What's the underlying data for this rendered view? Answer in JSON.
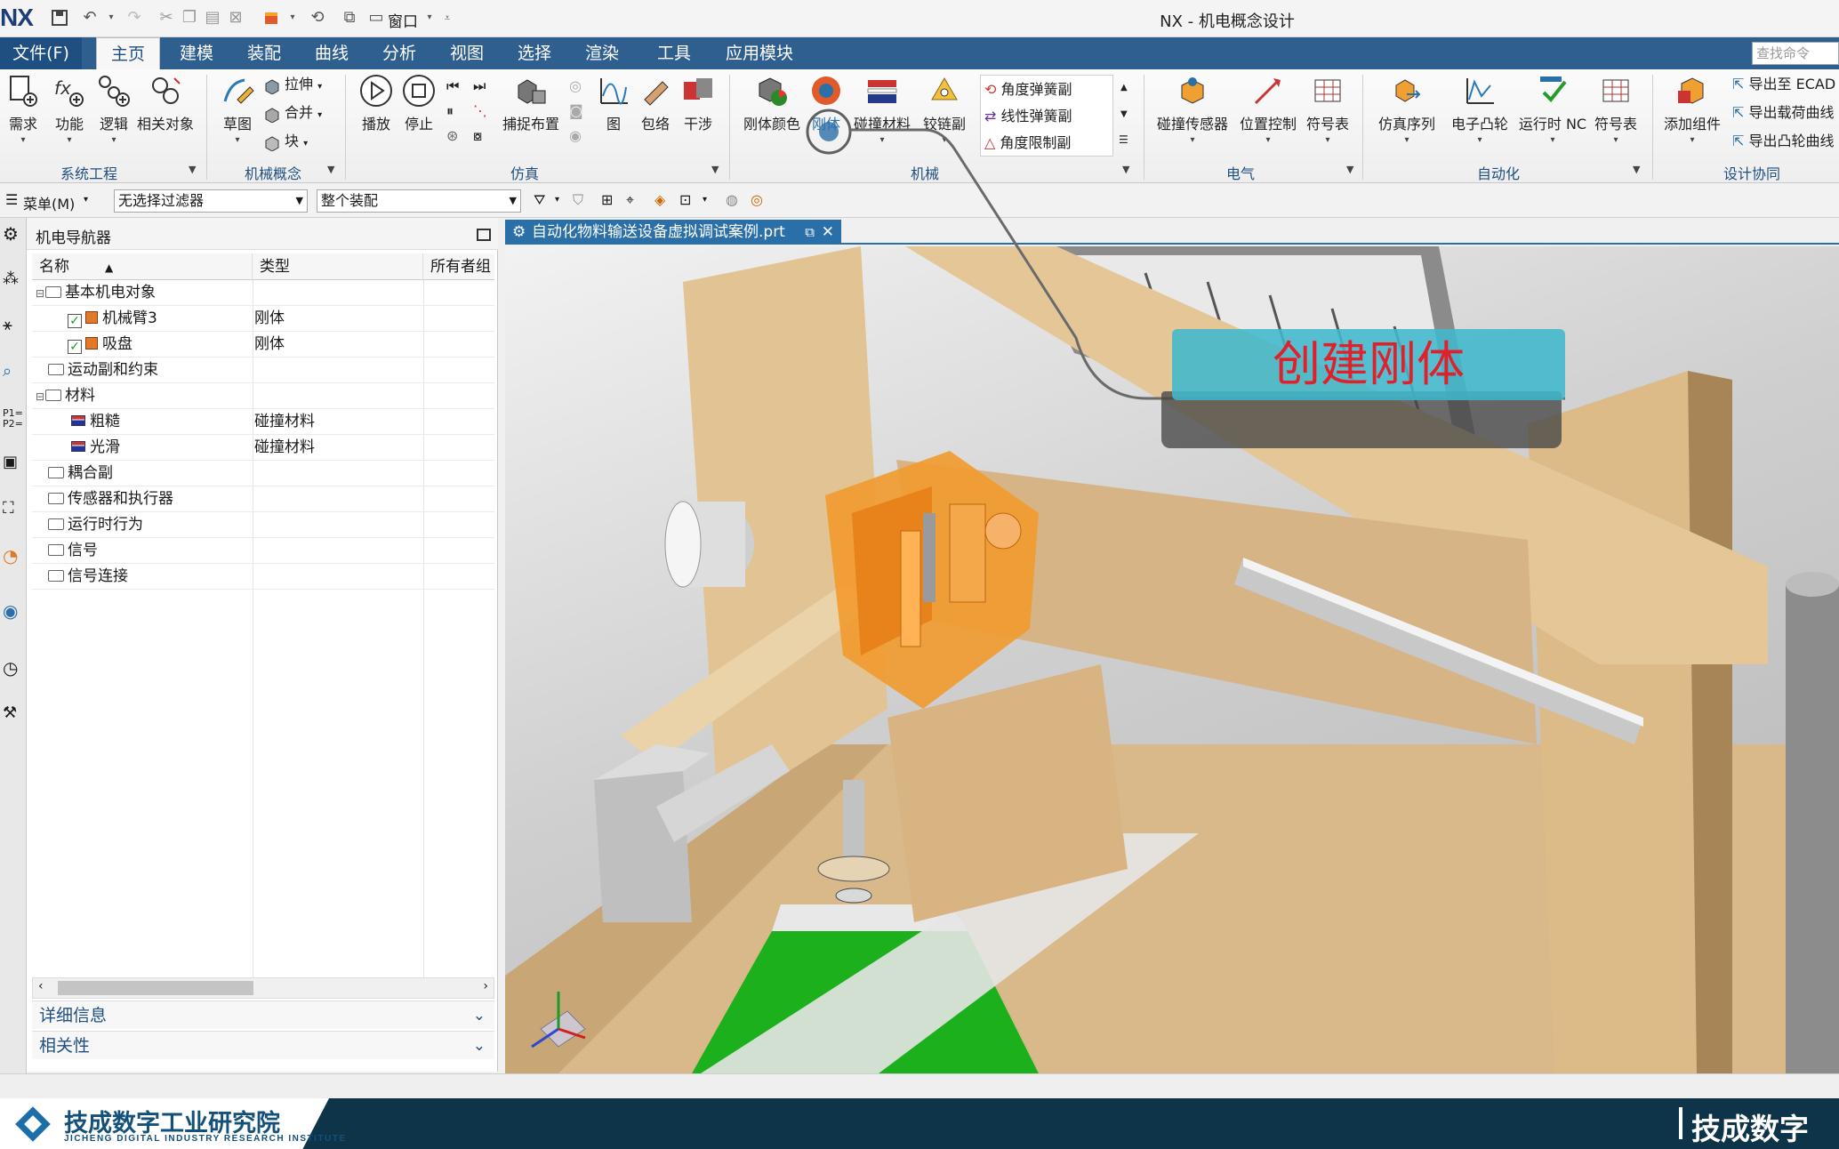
{
  "app": {
    "logo": "NX",
    "title": "NX - 机电概念设计"
  },
  "tabs": [
    {
      "label": "文件(F)"
    },
    {
      "label": "主页"
    },
    {
      "label": "建模"
    },
    {
      "label": "装配"
    },
    {
      "label": "曲线"
    },
    {
      "label": "分析"
    },
    {
      "label": "视图"
    },
    {
      "label": "选择"
    },
    {
      "label": "渲染"
    },
    {
      "label": "工具"
    },
    {
      "label": "应用模块"
    }
  ],
  "search": {
    "placeholder": "查找命令"
  },
  "quick_access": {
    "window_menu": "窗口"
  },
  "ribbon": {
    "system_engineering": {
      "label": "系统工程",
      "buttons": [
        "需求",
        "功能",
        "逻辑",
        "相关对象"
      ]
    },
    "mech_concept": {
      "label": "机械概念",
      "sketch": "草图",
      "extrude": "拉伸",
      "unite": "合并",
      "block": "块"
    },
    "simulation": {
      "label": "仿真",
      "play": "播放",
      "stop": "停止",
      "capture": "捕捉布置"
    },
    "mechanical": {
      "label": "机械",
      "buttons": [
        "图",
        "包络",
        "干涉",
        "刚体颜色",
        "刚体",
        "碰撞材料",
        "铰链副"
      ],
      "springs": [
        "角度弹簧副",
        "线性弹簧副",
        "角度限制副"
      ]
    },
    "electrical": {
      "label": "电气",
      "buttons": [
        "碰撞传感器",
        "位置控制",
        "符号表"
      ]
    },
    "automation": {
      "label": "自动化",
      "buttons": [
        "仿真序列",
        "电子凸轮",
        "运行时 NC",
        "符号表"
      ]
    },
    "design_collab": {
      "label": "设计协同",
      "add": "添加组件",
      "exports": [
        "导出至 ECAD",
        "导出载荷曲线",
        "导出凸轮曲线"
      ]
    }
  },
  "command_row": {
    "menu": "菜单(M)",
    "filter": "无选择过滤器",
    "scope": "整个装配"
  },
  "navigator": {
    "title": "机电导航器",
    "columns": [
      "名称",
      "类型",
      "所有者组"
    ],
    "rows": [
      {
        "name": "基本机电对象",
        "type": "",
        "kind": "folder",
        "level": 0,
        "expanded": true
      },
      {
        "name": "机械臂3",
        "type": "刚体",
        "kind": "rigid",
        "level": 1
      },
      {
        "name": "吸盘",
        "type": "刚体",
        "kind": "rigid",
        "level": 1
      },
      {
        "name": "运动副和约束",
        "type": "",
        "kind": "folder",
        "level": 0
      },
      {
        "name": "材料",
        "type": "",
        "kind": "folder",
        "level": 0,
        "expanded": true
      },
      {
        "name": "粗糙",
        "type": "碰撞材料",
        "kind": "material",
        "level": 1
      },
      {
        "name": "光滑",
        "type": "碰撞材料",
        "kind": "material",
        "level": 1
      },
      {
        "name": "耦合副",
        "type": "",
        "kind": "folder",
        "level": 0
      },
      {
        "name": "传感器和执行器",
        "type": "",
        "kind": "folder",
        "level": 0
      },
      {
        "name": "运行时行为",
        "type": "",
        "kind": "folder",
        "level": 0
      },
      {
        "name": "信号",
        "type": "",
        "kind": "folder",
        "level": 0
      },
      {
        "name": "信号连接",
        "type": "",
        "kind": "folder",
        "level": 0
      }
    ],
    "details_panel": "详细信息",
    "dependency_panel": "相关性"
  },
  "document": {
    "tab_label": "自动化物料输送设备虚拟调试案例.prt"
  },
  "callout": {
    "text": "创建刚体"
  },
  "brand": {
    "name": "技成数字工业研究院",
    "name_en": "JICHENG DIGITAL INDUSTRY RESEARCH INSTITUTE",
    "right": "技成数字"
  },
  "colors": {
    "ribbon_tab_bar": "#2f5f8f",
    "accent": "#1f4f80",
    "highlight_part": "#f29a2e",
    "conveyor": "#1cb01c",
    "frame_wood": "#d9b98a",
    "callout_fill": "#40b8cd",
    "callout_text": "#e0202a",
    "brand_bar": "#0d3448"
  }
}
